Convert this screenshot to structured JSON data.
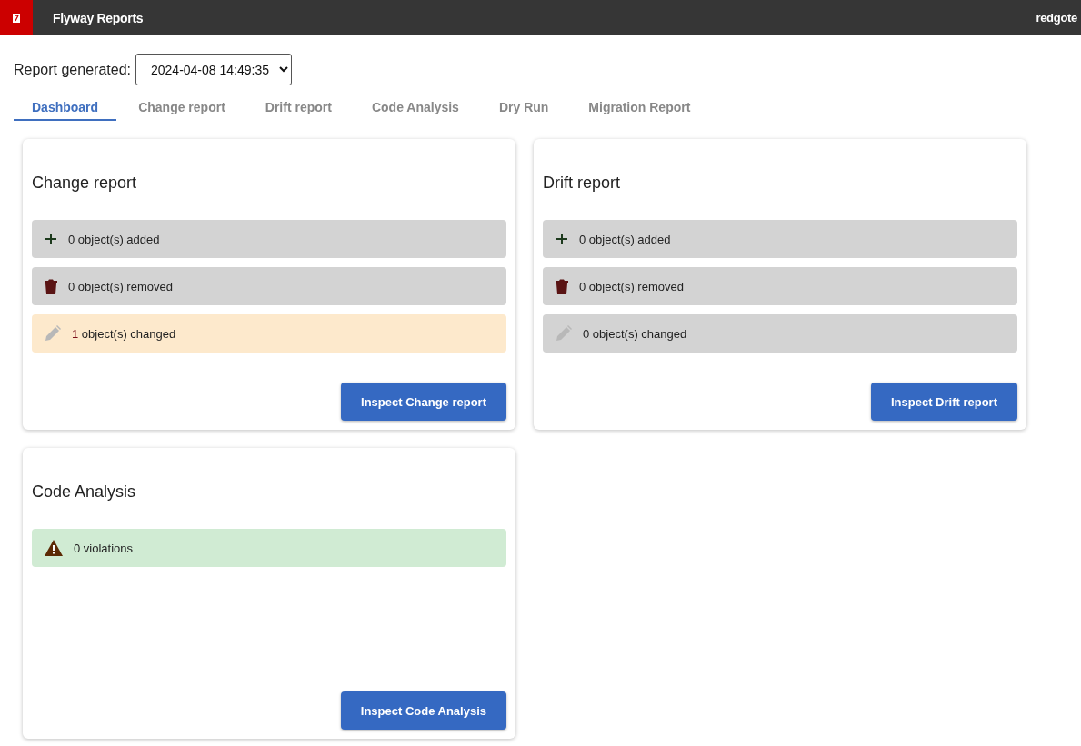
{
  "app_bar": {
    "title": "Flyway Reports",
    "brand": "redgote"
  },
  "report_generated": {
    "label": "Report generated:",
    "value": "2024-04-08 14:49:35"
  },
  "tabs": [
    {
      "label": "Dashboard",
      "selected": true
    },
    {
      "label": "Change report",
      "selected": false
    },
    {
      "label": "Drift report",
      "selected": false
    },
    {
      "label": "Code Analysis",
      "selected": false
    },
    {
      "label": "Dry Run",
      "selected": false
    },
    {
      "label": "Migration Report",
      "selected": false
    }
  ],
  "cards": [
    {
      "title": "Change report",
      "rows": [
        {
          "kind": "added",
          "color": "#d3d3d3",
          "highlighted": false,
          "count": "0",
          "label": "object(s) added"
        },
        {
          "kind": "removed",
          "color": "#d3d3d3",
          "highlighted": false,
          "count": "0",
          "label": "object(s) removed"
        },
        {
          "kind": "changed",
          "color": "#fde9cc",
          "highlighted": true,
          "count": "1",
          "label": "object(s) changed"
        }
      ],
      "button": "Inspect Change report"
    },
    {
      "title": "Drift report",
      "rows": [
        {
          "kind": "added",
          "color": "#d3d3d3",
          "highlighted": false,
          "count": "0",
          "label": "object(s) added"
        },
        {
          "kind": "removed",
          "color": "#d3d3d3",
          "highlighted": false,
          "count": "0",
          "label": "object(s) removed"
        },
        {
          "kind": "changed",
          "color": "#d3d3d3",
          "highlighted": false,
          "count": "0",
          "label": "object(s) changed"
        }
      ],
      "button": "Inspect Drift report"
    },
    {
      "title": "Code Analysis",
      "rows": [
        {
          "kind": "violations",
          "color": "#d0ebd3",
          "highlighted": false,
          "count": "0",
          "label": "violations"
        }
      ],
      "button": "Inspect Code Analysis"
    }
  ]
}
